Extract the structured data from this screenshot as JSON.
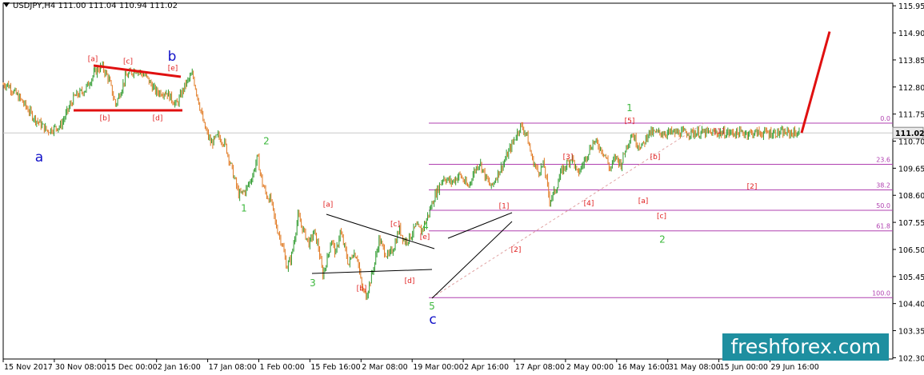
{
  "header": {
    "symbol_line": "USDJPY,H4  111.00 111.04 110.94 111.02"
  },
  "watermark": {
    "text": "freshforex.com"
  },
  "colors": {
    "bull_candle": "#2e9a2e",
    "bear_candle": "#e07820",
    "fib_line": "#b040b0",
    "wave_red": "#e02020",
    "wave_green": "#3db83d",
    "wave_blue": "#1010c8",
    "projection": "#e01010",
    "price_tag": "#e8e8e8"
  },
  "chart_data": {
    "type": "candlestick",
    "title": "USDJPY,H4",
    "ohlc": {
      "open": 111.0,
      "high": 111.04,
      "low": 110.94,
      "close": 111.02
    },
    "current_price": 111.02,
    "ylim": [
      102.25,
      116.05
    ],
    "y_ticks": [
      115.95,
      114.9,
      113.85,
      112.8,
      111.75,
      110.7,
      109.65,
      108.6,
      107.55,
      106.5,
      105.45,
      104.4,
      103.35,
      102.3
    ],
    "x_ticks": [
      "15 Nov 2017",
      "30 Nov 08:00",
      "15 Dec 00:00",
      "2 Jan 16:00",
      "17 Jan 08:00",
      "1 Feb 00:00",
      "15 Feb 16:00",
      "2 Mar 08:00",
      "19 Mar 00:00",
      "2 Apr 16:00",
      "17 Apr 08:00",
      "2 May 00:00",
      "16 May 16:00",
      "31 May 08:00",
      "15 Jun 00:00",
      "29 Jun 16:00"
    ],
    "price_path": [
      [
        "15 Nov 2017",
        112.9
      ],
      [
        "18 Nov",
        112.3
      ],
      [
        "21 Nov",
        111.6
      ],
      [
        "24 Nov",
        111.1
      ],
      [
        "27 Nov",
        111.3
      ],
      [
        "30 Nov",
        112.4
      ],
      [
        "3 Dec",
        112.7
      ],
      [
        "6 Dec",
        113.4
      ],
      [
        "8 Dec",
        113.6
      ],
      [
        "10 Dec",
        113.1
      ],
      [
        "12 Dec",
        112.1
      ],
      [
        "15 Dec",
        113.2
      ],
      [
        "18 Dec",
        113.5
      ],
      [
        "21 Dec",
        113.2
      ],
      [
        "24 Dec",
        112.6
      ],
      [
        "27 Dec",
        112.6
      ],
      [
        "30 Dec",
        112.1
      ],
      [
        "2 Jan",
        112.9
      ],
      [
        "5 Jan",
        113.3
      ],
      [
        "7 Jan",
        112.5
      ],
      [
        "10 Jan",
        111.3
      ],
      [
        "13 Jan",
        110.6
      ],
      [
        "16 Jan",
        110.9
      ],
      [
        "19 Jan",
        110.6
      ],
      [
        "22 Jan",
        109.6
      ],
      [
        "25 Jan",
        108.6
      ],
      [
        "28 Jan",
        108.8
      ],
      [
        "31 Jan",
        109.4
      ],
      [
        "2 Feb",
        110.1
      ],
      [
        "4 Feb",
        109.1
      ],
      [
        "6 Feb",
        108.6
      ],
      [
        "8 Feb",
        108.4
      ],
      [
        "10 Feb",
        107.5
      ],
      [
        "13 Feb",
        106.7
      ],
      [
        "15 Feb",
        105.8
      ],
      [
        "17 Feb",
        106.2
      ],
      [
        "20 Feb",
        107.8
      ],
      [
        "22 Feb",
        107.3
      ],
      [
        "25 Feb",
        106.7
      ],
      [
        "27 Feb",
        107.2
      ],
      [
        "1 Mar",
        106.6
      ],
      [
        "3 Mar",
        105.5
      ],
      [
        "5 Mar",
        106.1
      ],
      [
        "7 Mar",
        106.9
      ],
      [
        "9 Mar",
        106.3
      ],
      [
        "11 Mar",
        107.2
      ],
      [
        "13 Mar",
        106.6
      ],
      [
        "15 Mar",
        105.9
      ],
      [
        "17 Mar",
        106.4
      ],
      [
        "19 Mar",
        106.2
      ],
      [
        "21 Mar",
        105.0
      ],
      [
        "23 Mar",
        104.7
      ],
      [
        "25 Mar",
        105.3
      ],
      [
        "27 Mar",
        106.0
      ],
      [
        "29 Mar",
        106.9
      ],
      [
        "31 Mar",
        106.5
      ],
      [
        "2 Apr",
        106.2
      ],
      [
        "4 Apr",
        106.6
      ],
      [
        "6 Apr",
        107.3
      ],
      [
        "8 Apr",
        106.8
      ],
      [
        "10 Apr",
        107.0
      ],
      [
        "12 Apr",
        107.4
      ],
      [
        "14 Apr",
        107.2
      ],
      [
        "16 Apr",
        107.7
      ],
      [
        "19 Apr",
        108.6
      ],
      [
        "22 Apr",
        109.3
      ],
      [
        "25 Apr",
        109.1
      ],
      [
        "28 Apr",
        109.4
      ],
      [
        "1 May",
        108.9
      ],
      [
        "3 May",
        109.5
      ],
      [
        "5 May",
        109.9
      ],
      [
        "7 May",
        109.3
      ],
      [
        "9 May",
        108.9
      ],
      [
        "11 May",
        109.4
      ],
      [
        "13 May",
        109.8
      ],
      [
        "15 May",
        110.3
      ],
      [
        "17 May",
        110.8
      ],
      [
        "19 May",
        111.3
      ],
      [
        "21 May",
        111.0
      ],
      [
        "23 May",
        110.0
      ],
      [
        "25 May",
        109.5
      ],
      [
        "27 May",
        109.8
      ],
      [
        "29 May",
        108.4
      ],
      [
        "31 May",
        108.8
      ],
      [
        "2 Jun",
        109.5
      ],
      [
        "4 Jun",
        109.8
      ],
      [
        "6 Jun",
        110.1
      ],
      [
        "8 Jun",
        109.4
      ],
      [
        "10 Jun",
        109.8
      ],
      [
        "12 Jun",
        110.3
      ],
      [
        "14 Jun",
        110.7
      ],
      [
        "16 Jun",
        110.5
      ],
      [
        "18 Jun",
        110.2
      ],
      [
        "20 Jun",
        109.6
      ],
      [
        "22 Jun",
        110.1
      ],
      [
        "24 Jun",
        109.8
      ],
      [
        "26 Jun",
        110.5
      ],
      [
        "28 Jun",
        111.0
      ],
      [
        "30 Jun",
        110.6
      ],
      [
        "2 Jul",
        110.5
      ],
      [
        "4 Jul",
        111.02
      ]
    ],
    "fibonacci": {
      "low": 104.63,
      "high": 111.4,
      "levels": [
        {
          "ratio": 0.0,
          "label": "0.0",
          "price": 111.4
        },
        {
          "ratio": 0.236,
          "label": "23.6",
          "price": 109.8
        },
        {
          "ratio": 0.382,
          "label": "38.2",
          "price": 108.81
        },
        {
          "ratio": 0.5,
          "label": "50.0",
          "price": 108.02
        },
        {
          "ratio": 0.618,
          "label": "61.8",
          "price": 107.22
        },
        {
          "ratio": 1.0,
          "label": "100.0",
          "price": 104.63
        }
      ]
    },
    "projection": {
      "from": 111.02,
      "to": 114.95
    },
    "wave_labels": [
      {
        "text": "a",
        "color": "blue",
        "price": 110.1,
        "time": "24 Nov"
      },
      {
        "text": "b",
        "color": "blue",
        "price": 114.0,
        "time": "6 Jan"
      },
      {
        "text": "c",
        "color": "blue",
        "price": 103.8,
        "time": "21 Mar"
      },
      {
        "text": "[a]",
        "color": "red",
        "price": 113.9,
        "time": "6 Dec"
      },
      {
        "text": "[b]",
        "color": "red",
        "price": 111.6,
        "time": "12 Dec"
      },
      {
        "text": "[c]",
        "color": "red",
        "price": 113.8,
        "time": "18 Dec"
      },
      {
        "text": "[d]",
        "color": "red",
        "price": 111.6,
        "time": "30 Dec"
      },
      {
        "text": "[e]",
        "color": "red",
        "price": 113.55,
        "time": "5 Jan"
      },
      {
        "text": "1",
        "color": "green",
        "price": 108.1,
        "time": "31 Jan"
      },
      {
        "text": "2",
        "color": "green",
        "price": 110.7,
        "time": "2 Feb"
      },
      {
        "text": "3",
        "color": "green",
        "price": 105.2,
        "time": "15 Feb"
      },
      {
        "text": "[a]",
        "color": "red",
        "price": 108.25,
        "time": "20 Feb"
      },
      {
        "text": "[b]",
        "color": "red",
        "price": 105.0,
        "time": "3 Mar"
      },
      {
        "text": "[c]",
        "color": "red",
        "price": 107.5,
        "time": "11 Mar"
      },
      {
        "text": "[d]",
        "color": "red",
        "price": 105.3,
        "time": "15 Mar"
      },
      {
        "text": "[e]",
        "color": "red",
        "price": 107.0,
        "time": "17 Mar"
      },
      {
        "text": "4",
        "color": "green",
        "price": 107.4,
        "time": "18 Mar"
      },
      {
        "text": "5",
        "color": "green",
        "price": 104.3,
        "time": "21 Mar"
      },
      {
        "text": "[1]",
        "color": "red",
        "price": 108.2,
        "time": "12 Apr"
      },
      {
        "text": "[2]",
        "color": "red",
        "price": 106.5,
        "time": "14 Apr"
      },
      {
        "text": "[3]",
        "color": "red",
        "price": 110.1,
        "time": "5 May"
      },
      {
        "text": "[4]",
        "color": "red",
        "price": 108.3,
        "time": "9 May"
      },
      {
        "text": "[5]",
        "color": "red",
        "price": 111.5,
        "time": "19 May"
      },
      {
        "text": "1",
        "color": "green",
        "price": 112.0,
        "time": "19 May"
      },
      {
        "text": "[b]",
        "color": "red",
        "price": 110.1,
        "time": "25 May"
      },
      {
        "text": "[a]",
        "color": "red",
        "price": 108.4,
        "time": "23 May"
      },
      {
        "text": "[c]",
        "color": "red",
        "price": 107.8,
        "time": "29 May"
      },
      {
        "text": "2",
        "color": "green",
        "price": 106.9,
        "time": "29 May"
      },
      {
        "text": "[1]",
        "color": "red",
        "price": 111.1,
        "time": "14 Jun"
      },
      {
        "text": "[2]",
        "color": "red",
        "price": 108.95,
        "time": "20 Jun"
      }
    ]
  }
}
